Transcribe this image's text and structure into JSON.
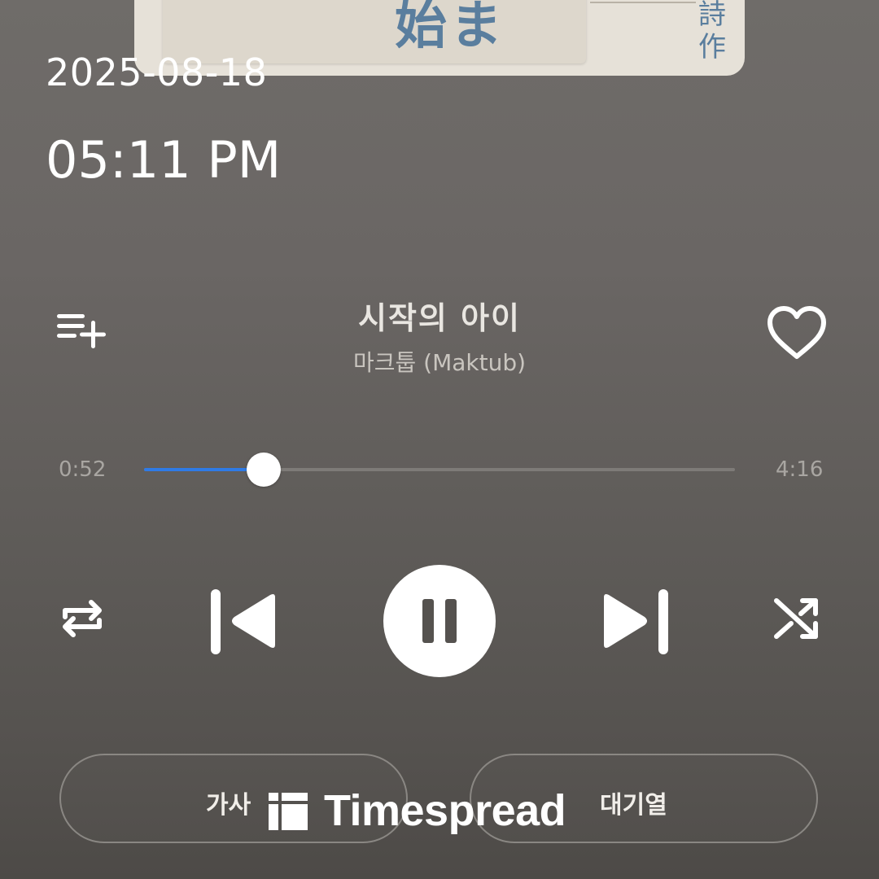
{
  "status": {
    "date": "2025-08-18",
    "time": "05:11 PM"
  },
  "album_art": {
    "title_glyphs": "始ま",
    "side_glyphs": [
      "詩",
      "作"
    ]
  },
  "track": {
    "title": "시작의 아이",
    "artist": "마크툽 (Maktub)",
    "liked": false
  },
  "progress": {
    "current": "0:52",
    "total": "4:16",
    "fraction": 0.2031
  },
  "controls": {
    "queue_add_icon": "playlist-add-icon",
    "like_icon": "heart-outline-icon",
    "repeat_icon": "repeat-icon",
    "previous_icon": "skip-previous-icon",
    "playpause_icon": "pause-icon",
    "next_icon": "skip-next-icon",
    "shuffle_icon": "shuffle-icon"
  },
  "bottom": {
    "lyrics_label": "가사",
    "queue_label": "대기열"
  },
  "watermark": {
    "text": "Timespread"
  },
  "colors": {
    "accent": "#2f7be6",
    "text": "#ffffff",
    "muted": "#a9a6a2"
  }
}
